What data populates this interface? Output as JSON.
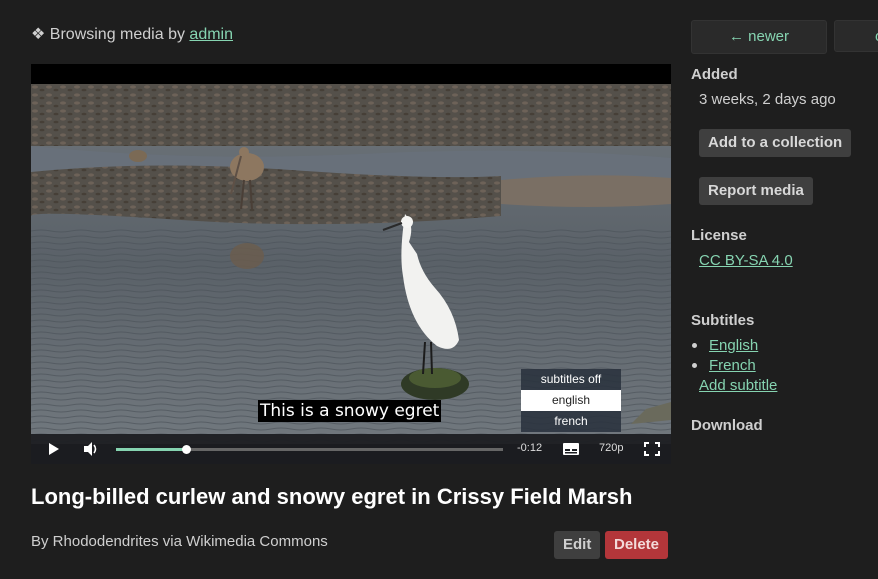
{
  "breadcrumb": {
    "icon": "❖",
    "prefix": "Browsing media by",
    "user": "admin"
  },
  "player": {
    "caption": "This is a snowy egret",
    "subtitle_menu": [
      "subtitles off",
      "english",
      "french"
    ],
    "selected_subtitle": "english",
    "time_remaining": "-0:12",
    "quality": "720p",
    "progress": 0.18
  },
  "media": {
    "title": "Long-billed curlew and snowy egret in Crissy Field Marsh",
    "byline": "By Rhododendrites via Wikimedia Commons"
  },
  "actions": {
    "edit": "Edit",
    "delete": "Delete"
  },
  "sidebar": {
    "newer": "← newer",
    "older_partial": "o",
    "added_heading": "Added",
    "added_value": "3 weeks, 2 days ago",
    "add_collection": "Add to a collection",
    "report": "Report media",
    "license_heading": "License",
    "license_value": "CC BY-SA 4.0",
    "subtitles_heading": "Subtitles",
    "subtitles": [
      "English",
      "French"
    ],
    "add_subtitle": "Add subtitle",
    "download_heading": "Download"
  },
  "colors": {
    "accent": "#86d4b1",
    "danger": "#b3363a",
    "background": "#1e1e1e"
  }
}
